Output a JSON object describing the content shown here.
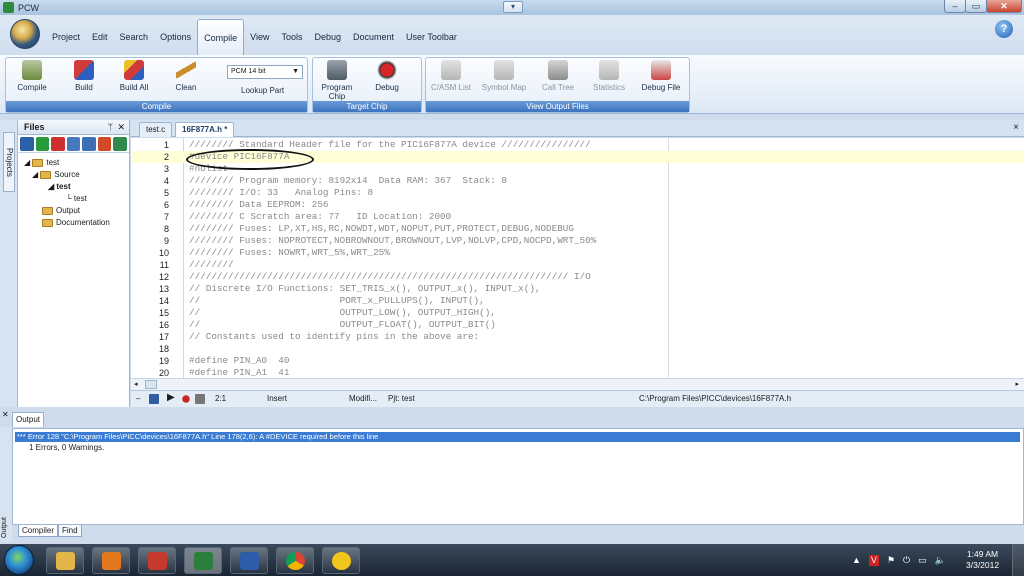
{
  "window": {
    "title": "PCW",
    "quick_access": "▾"
  },
  "ribbon": {
    "tabs": [
      "Project",
      "Edit",
      "Search",
      "Options",
      "Compile",
      "View",
      "Tools",
      "Debug",
      "Document",
      "User Toolbar"
    ],
    "active_tab": "Compile",
    "compile_group": {
      "label": "Compile",
      "buttons": [
        "Compile",
        "Build",
        "Build All",
        "Clean"
      ],
      "compiler_select": "PCM 14 bit",
      "lookup_part": "Lookup Part"
    },
    "target_group": {
      "label": "Target Chip",
      "program_chip": "Program Chip",
      "debug": "Debug"
    },
    "output_group": {
      "label": "View Output Files",
      "buttons": [
        "C/ASM List",
        "Symbol Map",
        "Call Tree",
        "Statistics",
        "Debug File"
      ]
    }
  },
  "files_panel": {
    "title": "Files",
    "pin": "ᛘ",
    "close": "✕",
    "side_tab": "Projects",
    "tree": [
      "test",
      "Source",
      "test",
      "test",
      "Output",
      "Documentation"
    ]
  },
  "editor": {
    "tabs": [
      "test.c",
      "16F877A.h *"
    ],
    "close": "×",
    "lines": [
      {
        "n": "1",
        "text": "//////// Standard Header file for the PIC16F877A device ////////////////"
      },
      {
        "n": "2",
        "text": "#device PIC16F877A"
      },
      {
        "n": "3",
        "text": "#nolist"
      },
      {
        "n": "4",
        "text": "//////// Program memory: 8192x14  Data RAM: 367  Stack: 8"
      },
      {
        "n": "5",
        "text": "//////// I/O: 33   Analog Pins: 8"
      },
      {
        "n": "6",
        "text": "//////// Data EEPROM: 256"
      },
      {
        "n": "7",
        "text": "//////// C Scratch area: 77   ID Location: 2000"
      },
      {
        "n": "8",
        "text": "//////// Fuses: LP,XT,HS,RC,NOWDT,WDT,NOPUT,PUT,PROTECT,DEBUG,NODEBUG"
      },
      {
        "n": "9",
        "text": "//////// Fuses: NOPROTECT,NOBROWNOUT,BROWNOUT,LVP,NOLVP,CPD,NOCPD,WRT_50%"
      },
      {
        "n": "10",
        "text": "//////// Fuses: NOWRT,WRT_5%,WRT_25%"
      },
      {
        "n": "11",
        "text": "////////"
      },
      {
        "n": "12",
        "text": "//////////////////////////////////////////////////////////////////// I/O"
      },
      {
        "n": "13",
        "text": "// Discrete I/O Functions: SET_TRIS_x(), OUTPUT_x(), INPUT_x(),"
      },
      {
        "n": "14",
        "text": "//                         PORT_x_PULLUPS(), INPUT(),"
      },
      {
        "n": "15",
        "text": "//                         OUTPUT_LOW(), OUTPUT_HIGH(),"
      },
      {
        "n": "16",
        "text": "//                         OUTPUT_FLOAT(), OUTPUT_BIT()"
      },
      {
        "n": "17",
        "text": "// Constants used to identify pins in the above are:"
      },
      {
        "n": "18",
        "text": ""
      },
      {
        "n": "19",
        "text": "#define PIN_A0  40"
      },
      {
        "n": "20",
        "text": "#define PIN_A1  41"
      }
    ]
  },
  "statusbar": {
    "position": "2:1",
    "mode": "Insert",
    "modified": "Modifi...",
    "project": "Pjt: test",
    "path": "C:\\Program Files\\PICC\\devices\\16F877A.h"
  },
  "output": {
    "tab": "Output",
    "side_label": "Output",
    "error_line": "*** Error 128 \"C:\\Program Files\\PICC\\devices\\16F877A.h\" Line 178(2,6): A #DEVICE required before this line",
    "summary": "1 Errors,  0 Warnings.",
    "bottom_tabs": [
      "Compiler",
      "Find"
    ]
  },
  "taskbar": {
    "time": "1:49 AM",
    "date": "3/3/2012"
  },
  "colors": {
    "accent": "#3c73bf",
    "error_highlight": "#3a7cd4",
    "keyword": "#c8201e",
    "number": "#2a9b2a"
  }
}
